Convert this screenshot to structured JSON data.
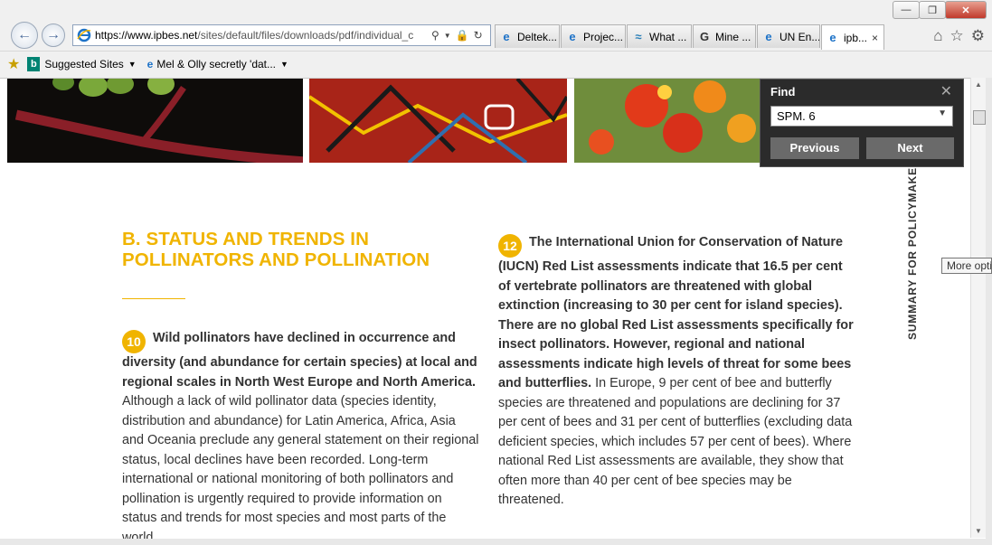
{
  "browser": {
    "address_url_domain": "https://www.ipbes.net",
    "address_url_rest": "/sites/default/files/downloads/pdf/individual_c",
    "tabs": [
      {
        "label": "Deltek...",
        "icon": "ie-icon"
      },
      {
        "label": "Projec...",
        "icon": "ie-icon"
      },
      {
        "label": "What ...",
        "icon": "wave-icon"
      },
      {
        "label": "Mine ...",
        "icon": "google-icon"
      },
      {
        "label": "UN En...",
        "icon": "ie-icon"
      },
      {
        "label": "ipb...",
        "icon": "ie-icon",
        "active": true
      }
    ],
    "favorites": {
      "suggested": "Suggested Sites",
      "item2": "Mel & Olly secretly 'dat..."
    }
  },
  "find_bar": {
    "title": "Find",
    "query": "SPM. 6",
    "previous": "Previous",
    "next": "Next"
  },
  "tooltip": "More options",
  "document": {
    "section_heading_line1": "B. STATUS AND TRENDS IN",
    "section_heading_line2": "POLLINATORS AND POLLINATION",
    "side_label": "SUMMARY FOR POLICYMAKERS",
    "p10": {
      "number": "10",
      "bold": "Wild pollinators have declined in occurrence and diversity (and abundance for certain species) at local and regional scales in North West Europe and North America.",
      "text": " Although a lack of wild pollinator data (species identity, distribution and abundance) for Latin America, Africa, Asia and Oceania preclude any general statement on their regional status, local declines have been recorded. Long-term international or national monitoring of both pollinators and pollination is urgently required to provide information on status and trends for most species and most parts of the world."
    },
    "p12": {
      "number": "12",
      "bold": "The International Union for Conservation of Nature (IUCN) Red List assessments indicate that 16.5 per cent of vertebrate pollinators are threatened with global extinction (increasing to 30 per cent for island species). There are no global Red List assessments specifically for insect pollinators. However, regional and national assessments indicate high levels of threat for some bees and butterflies.",
      "text": " In Europe, 9 per cent of bee and butterfly species are threatened and populations are declining for 37 per cent of bees and 31 per cent of butterflies (excluding data deficient species, which includes 57 per cent of bees). Where national Red List assessments are available, they show that often more than 40 per cent of bee species may be threatened."
    }
  }
}
